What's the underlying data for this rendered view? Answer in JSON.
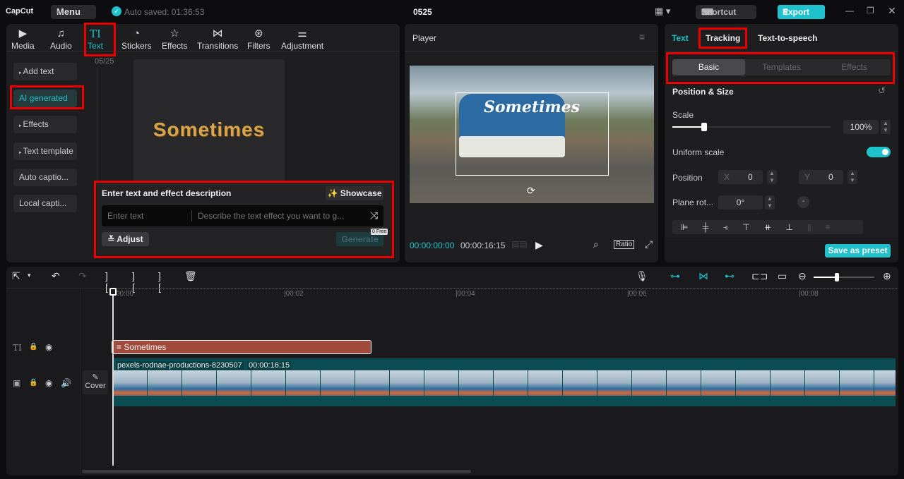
{
  "app": {
    "logo": "CapCut",
    "menu": "Menu",
    "autosave": "Auto saved: 01:36:53",
    "project": "0525",
    "shortcut": "Shortcut",
    "export": "Export"
  },
  "tabs": [
    {
      "label": "Media",
      "icon": "media-icon"
    },
    {
      "label": "Audio",
      "icon": "audio-icon"
    },
    {
      "label": "Text",
      "icon": "text-icon"
    },
    {
      "label": "Stickers",
      "icon": "sticker-icon"
    },
    {
      "label": "Effects",
      "icon": "effects-icon"
    },
    {
      "label": "Transitions",
      "icon": "transitions-icon"
    },
    {
      "label": "Filters",
      "icon": "filters-icon"
    },
    {
      "label": "Adjustment",
      "icon": "adjustment-icon"
    }
  ],
  "sidebar": [
    "Add text",
    "AI generated",
    "Effects",
    "Text template",
    "Auto captio...",
    "Local capti..."
  ],
  "ai": {
    "date": "05/25",
    "preview_text": "Sometimes",
    "title": "Enter text and effect description",
    "showcase": "Showcase",
    "text_placeholder": "Enter text",
    "desc_placeholder": "Describe the text effect you want to g...",
    "adjust": "Adjust",
    "free": "Free",
    "free_count": "0",
    "generate": "Generate"
  },
  "player": {
    "title": "Player",
    "overlay_text": "Sometimes",
    "current": "00:00:00:00",
    "total": "00:00:16:15",
    "ratio": "Ratio"
  },
  "inspector": {
    "tabs": [
      "Text",
      "Tracking",
      "Text-to-speech"
    ],
    "subtabs": [
      "Basic",
      "Templates",
      "Effects"
    ],
    "section": "Position & Size",
    "scale_label": "Scale",
    "scale": "100%",
    "scale_value": 100,
    "uniform": "Uniform scale",
    "uniform_on": true,
    "position": "Position",
    "x_label": "X",
    "x": "0",
    "y_label": "Y",
    "y": "0",
    "rotation_label": "Plane rot...",
    "rotation": "0°",
    "save_preset": "Save as preset"
  },
  "timeline": {
    "ticks": [
      "00:00",
      "|00:02",
      "|00:04",
      "|00:06",
      "|00:08"
    ],
    "text_clip": "Sometimes",
    "video_clip": "pexels-rodnae-productions-8230507",
    "video_duration": "00:00:16:15",
    "cover": "Cover"
  },
  "colors": {
    "accent": "#1fc2cc",
    "text_clip": "#a04a3c",
    "video_track": "#0b4d52"
  }
}
